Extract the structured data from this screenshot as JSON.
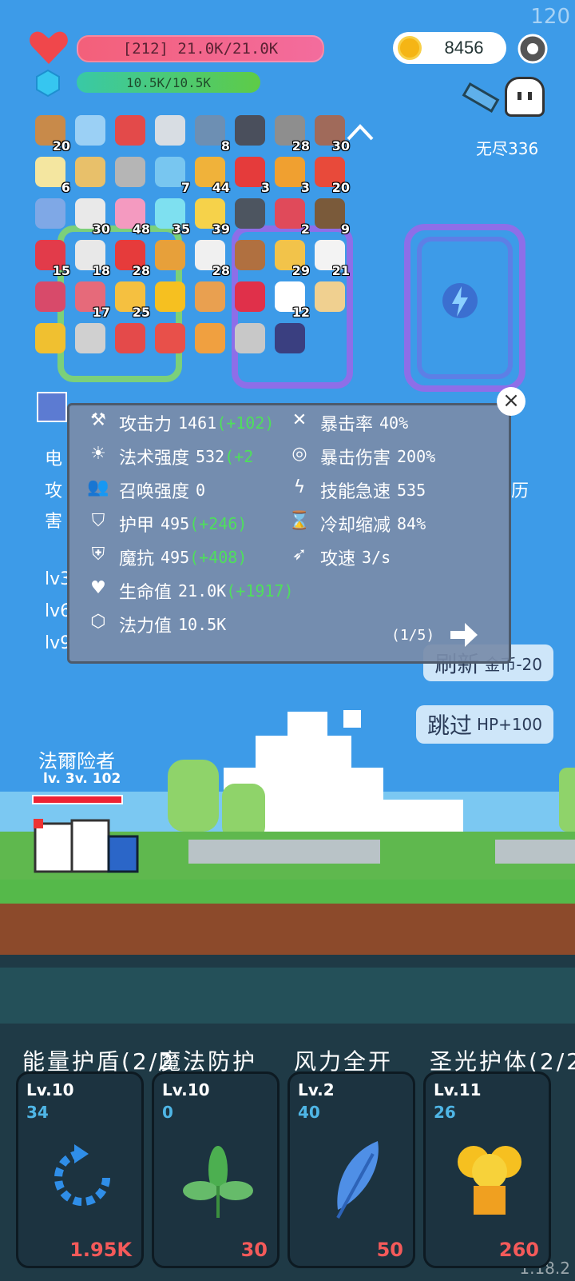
{
  "fps": "120",
  "version": "1.18.2",
  "hp_bar": {
    "text": "[212] 21.0K/21.0K"
  },
  "mp_bar": {
    "text": "10.5K/10.5K"
  },
  "coins": "8456",
  "endless_mode": "无尽336",
  "items": [
    {
      "icon": "shield-wood-icon",
      "count": "20"
    },
    {
      "icon": "empty-slot-icon",
      "count": ""
    },
    {
      "icon": "magnet-icon",
      "count": ""
    },
    {
      "icon": "sword-icon",
      "count": ""
    },
    {
      "icon": "sword-blue-icon",
      "count": "8"
    },
    {
      "icon": "skull-book-icon",
      "count": ""
    },
    {
      "icon": "spike-ball-icon",
      "count": "28"
    },
    {
      "icon": "tombstone-icon",
      "count": "30"
    },
    {
      "icon": "flower-icon",
      "count": "6"
    },
    {
      "icon": "scroll-icon",
      "count": ""
    },
    {
      "icon": "viking-helmet-icon",
      "count": ""
    },
    {
      "icon": "potion-flask-icon",
      "count": "7"
    },
    {
      "icon": "golden-egg-icon",
      "count": "44"
    },
    {
      "icon": "apple-icon",
      "count": "3"
    },
    {
      "icon": "spellbook-icon",
      "count": "3"
    },
    {
      "icon": "sock-icon",
      "count": "20"
    },
    {
      "icon": "robe-icon",
      "count": ""
    },
    {
      "icon": "playing-cards-icon",
      "count": "30"
    },
    {
      "icon": "ice-cream-icon",
      "count": "48"
    },
    {
      "icon": "wand-icon",
      "count": "35"
    },
    {
      "icon": "battery-icon",
      "count": "39"
    },
    {
      "icon": "hood-icon",
      "count": ""
    },
    {
      "icon": "watermelon-icon",
      "count": "2"
    },
    {
      "icon": "coconut-icon",
      "count": "9"
    },
    {
      "icon": "strawberry-icon",
      "count": "15"
    },
    {
      "icon": "sparkle-icon",
      "count": "18"
    },
    {
      "icon": "red-card-icon",
      "count": "28"
    },
    {
      "icon": "meteor-icon",
      "count": ""
    },
    {
      "icon": "dice-icon",
      "count": "28"
    },
    {
      "icon": "meat-icon",
      "count": ""
    },
    {
      "icon": "notepad-icon",
      "count": "29"
    },
    {
      "icon": "envelope-icon",
      "count": "21"
    },
    {
      "icon": "jam-jar-icon",
      "count": ""
    },
    {
      "icon": "pill-icon",
      "count": "17"
    },
    {
      "icon": "cheese-icon",
      "count": "25"
    },
    {
      "icon": "sun-orb-icon",
      "count": ""
    },
    {
      "icon": "id-card-icon",
      "count": ""
    },
    {
      "icon": "ruby-icon",
      "count": ""
    },
    {
      "icon": "ghost-icon",
      "count": "12"
    },
    {
      "icon": "treasure-map-icon",
      "count": ""
    },
    {
      "icon": "ring-icon",
      "count": ""
    },
    {
      "icon": "axe-icon",
      "count": ""
    },
    {
      "icon": "hook-icon",
      "count": ""
    },
    {
      "icon": "sneaker-icon",
      "count": ""
    },
    {
      "icon": "crown-icon",
      "count": ""
    },
    {
      "icon": "hammer-icon",
      "count": ""
    },
    {
      "icon": "bible-icon",
      "count": ""
    }
  ],
  "background_text": {
    "line1": "电",
    "line2": "攻",
    "line3": "害",
    "right_fragment": "历",
    "lv_lines": [
      "lv3",
      "lv6",
      "lv9"
    ]
  },
  "stats_panel": {
    "left": [
      {
        "icon": "axe-icon",
        "label": "攻击力",
        "value": "1461",
        "bonus": "(+102)"
      },
      {
        "icon": "sun-icon",
        "label": "法术强度",
        "value": "532",
        "bonus": "(+2"
      },
      {
        "icon": "summon-icon",
        "label": "召唤强度",
        "value": "0",
        "bonus": ""
      },
      {
        "icon": "shield-icon",
        "label": "护甲",
        "value": "495",
        "bonus": "(+246)"
      },
      {
        "icon": "magic-shield-icon",
        "label": "魔抗",
        "value": "495",
        "bonus": "(+408)"
      },
      {
        "icon": "heart-icon",
        "label": "生命值",
        "value": "21.0K",
        "bonus": "(+1917)"
      },
      {
        "icon": "mana-gem-icon",
        "label": "法力值",
        "value": "10.5K",
        "bonus": ""
      }
    ],
    "right": [
      {
        "icon": "crit-icon",
        "label": "暴击率",
        "value": "40%"
      },
      {
        "icon": "crit-damage-icon",
        "label": "暴击伤害",
        "value": "200%"
      },
      {
        "icon": "lightning-icon",
        "label": "技能急速",
        "value": "535"
      },
      {
        "icon": "hourglass-icon",
        "label": "冷却缩减",
        "value": "84%"
      },
      {
        "icon": "bow-icon",
        "label": "攻速",
        "value": "3/s"
      }
    ],
    "page": "(1/5)"
  },
  "side_buttons": {
    "refresh": {
      "label": "刷新",
      "sub": "金币-20"
    },
    "skip": {
      "label": "跳过",
      "sub": "HP+100"
    }
  },
  "hero": {
    "name": "法爾险者",
    "level": "lv. 3v. 102"
  },
  "skills": [
    {
      "title": "能量护盾(2/2",
      "lv": "Lv.10",
      "num": "34",
      "cost": "1.95K",
      "icon": "refresh-circle-icon"
    },
    {
      "title": "魔法防护",
      "lv": "Lv.10",
      "num": "0",
      "cost": "30",
      "icon": "leaf-icon"
    },
    {
      "title": "风力全开",
      "lv": "Lv.2",
      "num": "40",
      "cost": "50",
      "icon": "feather-icon"
    },
    {
      "title": "圣光护体(2/2",
      "lv": "Lv.11",
      "num": "26",
      "cost": "260",
      "icon": "angel-icon"
    }
  ],
  "colors": {
    "sky": "#3d9be8",
    "hp": "#f3607a",
    "mp": "#5ecb47",
    "bonus": "#4ee05b",
    "cost": "#f45a5a",
    "skill_num": "#4fb6e6"
  }
}
